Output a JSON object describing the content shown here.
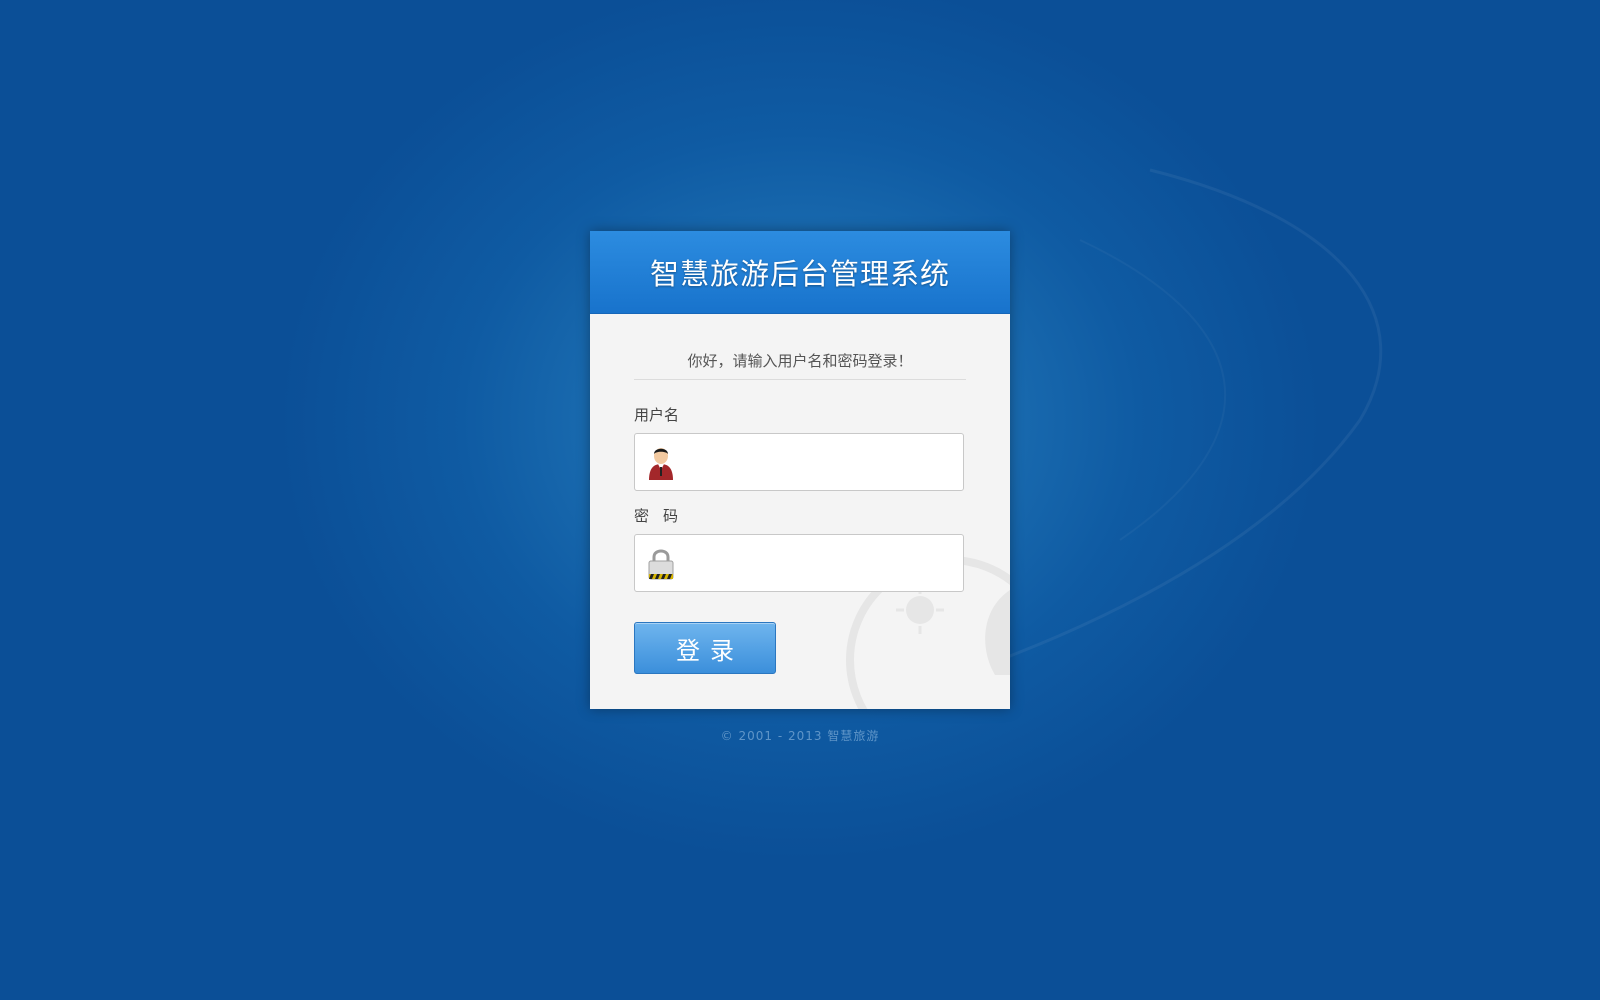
{
  "app": {
    "title": "智慧旅游后台管理系统"
  },
  "login": {
    "greeting": "你好，请输入用户名和密码登录！",
    "username_label": "用户名",
    "username_value": "",
    "password_label": "密码",
    "password_value": "",
    "submit_label": "登录"
  },
  "icons": {
    "username": "user-avatar-icon",
    "password": "padlock-icon"
  },
  "footer": {
    "copyright": "© 2001 - 2013 智慧旅游"
  },
  "colors": {
    "background": "#0f5ba3",
    "header": "#1f80d6",
    "button": "#4a9be0",
    "card": "#f4f4f4"
  }
}
